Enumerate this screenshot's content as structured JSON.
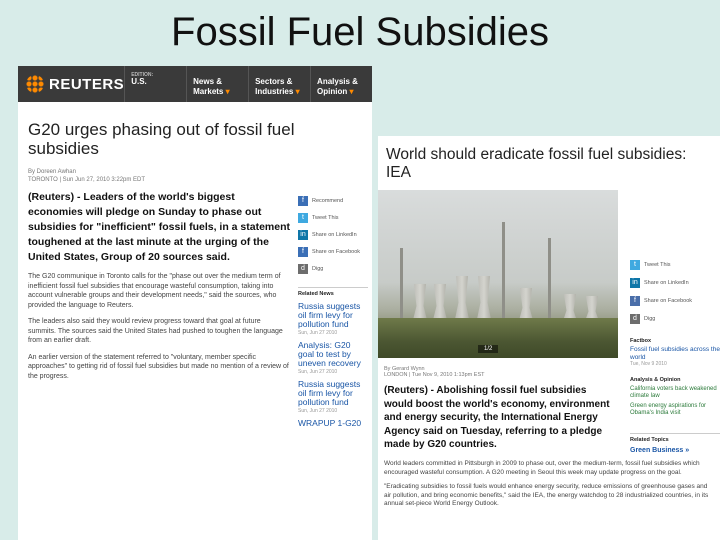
{
  "slide": {
    "title": "Fossil Fuel Subsidies"
  },
  "left": {
    "brand": "REUTERS",
    "nav": [
      {
        "small": "EDITION:",
        "label": "U.S.",
        "caret": ""
      },
      {
        "small": "",
        "label": "News & Markets",
        "caret": "▾"
      },
      {
        "small": "",
        "label": "Sectors & Industries",
        "caret": "▾"
      },
      {
        "small": "",
        "label": "Analysis & Opinion",
        "caret": "▾"
      }
    ],
    "headline": "G20 urges phasing out of fossil fuel subsidies",
    "byline": "By Doreen Awhan",
    "dateline": "TORONTO | Sun Jun 27, 2010 3:22pm EDT",
    "lede": "(Reuters) - Leaders of the world's biggest economies will pledge on Sunday to phase out subsidies for \"inefficient\" fossil fuels, in a statement toughened at the last minute at the urging of the United States, Group of 20 sources said.",
    "paragraphs": [
      "The G20 communique in Toronto calls for the \"phase out over the medium term of inefficient fossil fuel subsidies that encourage wasteful consumption, taking into account vulnerable groups and their development needs,\" said the sources, who provided the language to Reuters.",
      "The leaders also said they would review progress toward that goal at future summits. The sources said the United States had pushed to toughen the language from an earlier draft.",
      "An earlier version of the statement referred to \"voluntary, member specific approaches\" to getting rid of fossil fuel subsidies but made no mention of a review of the progress."
    ],
    "share": [
      {
        "label": "Recommend",
        "icon": "f"
      },
      {
        "label": "Tweet This",
        "icon": "t"
      },
      {
        "label": "Share on LinkedIn",
        "icon": "in"
      },
      {
        "label": "Share on Facebook",
        "icon": "f"
      },
      {
        "label": "Digg",
        "icon": "d"
      }
    ],
    "related_heading": "Related News",
    "related": [
      {
        "title": "Russia suggests oil firm levy for pollution fund",
        "date": "Sun, Jun 27 2010"
      },
      {
        "title": "Analysis: G20 goal to test by uneven recovery",
        "date": "Sun, Jun 27 2010"
      },
      {
        "title": "Russia suggests oil firm levy for pollution fund",
        "date": "Sun, Jun 27 2010"
      },
      {
        "title": "WRAPUP 1-G20",
        "date": ""
      }
    ]
  },
  "right": {
    "headline": "World should eradicate fossil fuel subsidies: IEA",
    "photo_pager": "1/2",
    "byline": "By Gerard Wynn",
    "dateline": "LONDON | Tue Nov 9, 2010 1:13pm EST",
    "lede": "(Reuters) - Abolishing fossil fuel subsidies would boost the world's economy, environment and energy security, the International Energy Agency said on Tuesday, referring to a pledge made by G20 countries.",
    "paragraphs": [
      "World leaders committed in Pittsburgh in 2009 to phase out, over the medium-term, fossil fuel subsidies which encouraged wasteful consumption. A G20 meeting in Seoul this week may update progress on the goal.",
      "\"Eradicating subsidies to fossil fuels would enhance energy security, reduce emissions of greenhouse gases and air pollution, and bring economic benefits,\" said the IEA, the energy watchdog to 28 industrialized countries, in its annual set-piece World Energy Outlook."
    ],
    "share": [
      {
        "label": "Tweet This",
        "icon": "t"
      },
      {
        "label": "Share on LinkedIn",
        "icon": "in"
      },
      {
        "label": "Share on Facebook",
        "icon": "f"
      },
      {
        "label": "Digg",
        "icon": "d"
      }
    ],
    "sections": [
      {
        "heading": "Factbox",
        "link": "Fossil fuel subsidies across the world",
        "date": "Tue, Nov 9 2010"
      },
      {
        "heading": "Analysis & Opinion",
        "link": "California voters back weakened climate law",
        "date": ""
      }
    ],
    "green_items": [
      "Green energy aspirations for Obama's India visit"
    ],
    "related_topics_heading": "Related Topics",
    "related_topic": "Green Business »"
  }
}
